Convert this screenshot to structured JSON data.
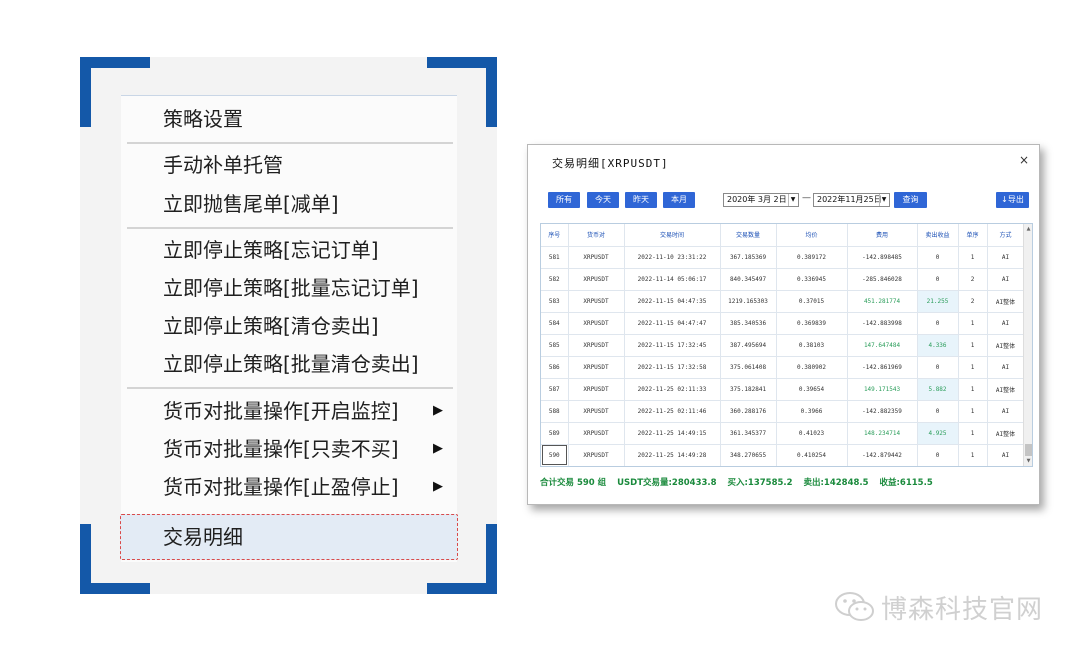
{
  "menu": {
    "items": [
      {
        "label": "策略设置"
      },
      {
        "label": "手动补单托管"
      },
      {
        "label": "立即抛售尾单[减单]"
      },
      {
        "label": "立即停止策略[忘记订单]"
      },
      {
        "label": "立即停止策略[批量忘记订单]"
      },
      {
        "label": "立即停止策略[清仓卖出]"
      },
      {
        "label": "立即停止策略[批量清仓卖出]"
      },
      {
        "label": "货币对批量操作[开启监控]",
        "arrow": "▶"
      },
      {
        "label": "货币对批量操作[只卖不买]",
        "arrow": "▶"
      },
      {
        "label": "货币对批量操作[止盈停止]",
        "arrow": "▶"
      },
      {
        "label": "交易明细"
      }
    ]
  },
  "dialog": {
    "title": "交易明细[XRPUSDT]",
    "close": "×",
    "buttons": [
      "所有",
      "今天",
      "昨天",
      "本月"
    ],
    "date_from": "2020年 3月 2日",
    "date_to": "2022年11月25日",
    "date_sep": "—",
    "query": "查询",
    "export": "↓导出",
    "columns": [
      "序号",
      "货币对",
      "交易时间",
      "交易数量",
      "均价",
      "费用",
      "卖出收益",
      "单序",
      "方式"
    ],
    "rows": [
      [
        "581",
        "XRPUSDT",
        "2022-11-10 23:31:22",
        "367.185369",
        "0.389172",
        "-142.898485",
        "0",
        "1",
        "AI"
      ],
      [
        "582",
        "XRPUSDT",
        "2022-11-14 05:06:17",
        "840.345497",
        "0.336945",
        "-285.846028",
        "0",
        "2",
        "AI"
      ],
      [
        "583",
        "XRPUSDT",
        "2022-11-15 04:47:35",
        "1219.165303",
        "0.37015",
        "451.281774",
        "21.255",
        "2",
        "AI整体"
      ],
      [
        "584",
        "XRPUSDT",
        "2022-11-15 04:47:47",
        "385.340536",
        "0.369839",
        "-142.883998",
        "0",
        "1",
        "AI"
      ],
      [
        "585",
        "XRPUSDT",
        "2022-11-15 17:32:45",
        "387.495694",
        "0.38103",
        "147.647484",
        "4.336",
        "1",
        "AI整体"
      ],
      [
        "586",
        "XRPUSDT",
        "2022-11-15 17:32:58",
        "375.061408",
        "0.380902",
        "-142.861969",
        "0",
        "1",
        "AI"
      ],
      [
        "587",
        "XRPUSDT",
        "2022-11-25 02:11:33",
        "375.182841",
        "0.39654",
        "149.171543",
        "5.882",
        "1",
        "AI整体"
      ],
      [
        "588",
        "XRPUSDT",
        "2022-11-25 02:11:46",
        "360.288176",
        "0.3966",
        "-142.882359",
        "0",
        "1",
        "AI"
      ],
      [
        "589",
        "XRPUSDT",
        "2022-11-25 14:49:15",
        "361.345377",
        "0.41023",
        "148.234714",
        "4.925",
        "1",
        "AI整体"
      ],
      [
        "590",
        "XRPUSDT",
        "2022-11-25 14:49:28",
        "348.270655",
        "0.410254",
        "-142.879442",
        "0",
        "1",
        "AI"
      ]
    ],
    "summary": {
      "count": "合计交易 590 组",
      "volume": "USDT交易量:280433.8",
      "buy": "买入:137585.2",
      "sell": "卖出:142848.5",
      "profit": "收益:6115.5"
    }
  },
  "watermark": {
    "text": "博森科技官网"
  }
}
